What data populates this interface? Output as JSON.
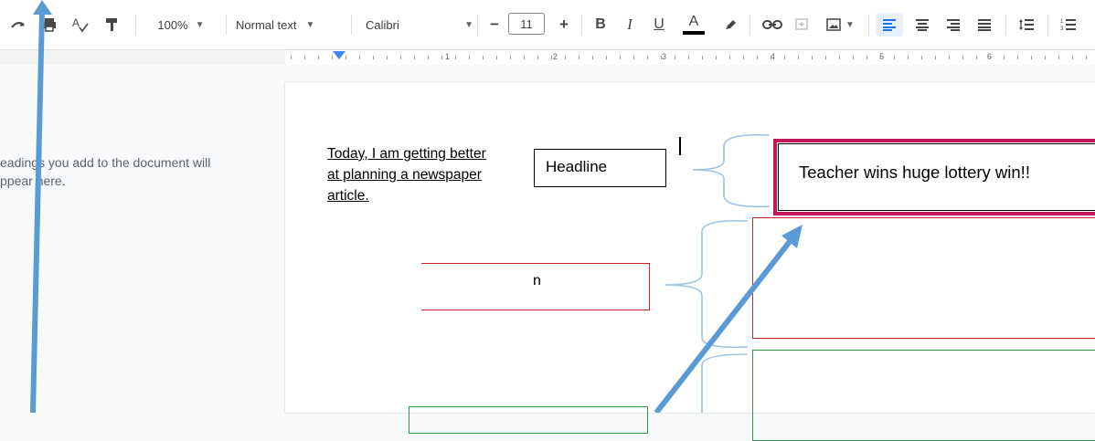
{
  "toolbar": {
    "zoom": "100%",
    "style": "Normal text",
    "font": "Calibri",
    "font_size": "11",
    "minus": "−",
    "plus": "+",
    "bold": "B",
    "italic": "I",
    "underline": "U",
    "text_color": "A"
  },
  "ruler": {
    "numbers": [
      "1",
      "2",
      "3",
      "4",
      "5",
      "6"
    ]
  },
  "outline": {
    "line1": "eadings you add to the document will",
    "line2": "ppear here."
  },
  "doc": {
    "objective_line1": "Today, I am getting better",
    "objective_line2": "at planning a newspaper",
    "objective_line3": "article.",
    "headline_label": "Headline",
    "headline_text": "Teacher wins huge lottery win!!",
    "partial_label": "n"
  },
  "colors": {
    "arrow": "#5b9bd5",
    "brace": "#9dc3e6",
    "title_border": "#c2185b",
    "red_box": "#c62828",
    "green_box": "#2e9e4a",
    "accent": "#1a73e8"
  }
}
